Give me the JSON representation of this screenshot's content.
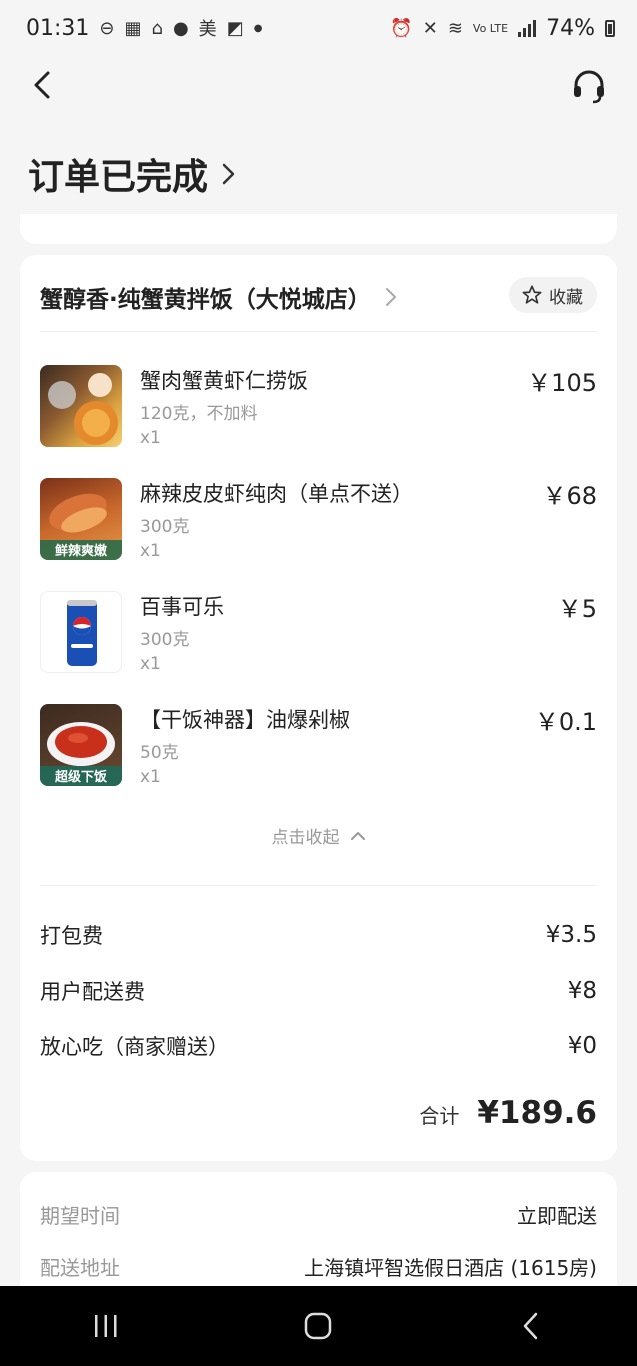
{
  "status_bar": {
    "time": "01:31",
    "app_icon_text": "美",
    "battery": "74%"
  },
  "header": {
    "title": "订单已完成"
  },
  "shop": {
    "name": "蟹醇香·纯蟹黄拌饭（大悦城店）",
    "favorite_label": "收藏"
  },
  "items": [
    {
      "name": "蟹肉蟹黄虾仁捞饭",
      "spec": "120克，不加料",
      "qty": "x1",
      "price": "￥105"
    },
    {
      "name": "麻辣皮皮虾纯肉（单点不送）",
      "spec": "300克",
      "qty": "x1",
      "price": "￥68",
      "thumb_badge": "鲜辣爽嫩"
    },
    {
      "name": "百事可乐",
      "spec": "300克",
      "qty": "x1",
      "price": "￥5"
    },
    {
      "name": "【干饭神器】油爆剁椒",
      "spec": "50克",
      "qty": "x1",
      "price": "￥0.1",
      "thumb_badge": "超级下饭"
    }
  ],
  "collapse_label": "点击收起",
  "fees": [
    {
      "label": "打包费",
      "value": "¥3.5"
    },
    {
      "label": "用户配送费",
      "value": "¥8"
    },
    {
      "label": "放心吃（商家赠送）",
      "value": "¥0"
    }
  ],
  "total": {
    "label": "合计",
    "value": "¥189.6"
  },
  "info": [
    {
      "label": "期望时间",
      "value": "立即配送"
    },
    {
      "label": "配送地址",
      "value": "上海镇坪智选假日酒店 (1615房)"
    }
  ],
  "colors": {
    "background": "#f5f5f5",
    "card": "#ffffff",
    "muted": "#999999",
    "navbar": "#000000"
  }
}
